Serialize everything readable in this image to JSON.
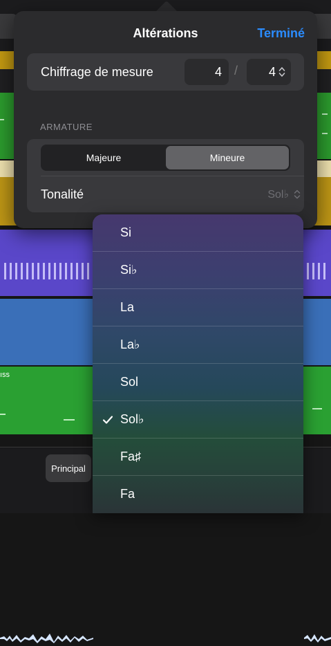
{
  "popover": {
    "title": "Altérations",
    "done_label": "Terminé",
    "time_signature": {
      "label": "Chiffrage de mesure",
      "numerator": "4",
      "separator": "/",
      "denominator": "4"
    },
    "armature": {
      "section_header": "ARMATURE",
      "segments": [
        "Majeure",
        "Mineure"
      ],
      "selected_segment": "Mineure",
      "key_label": "Tonalité",
      "key_value": "Sol♭"
    }
  },
  "key_menu": {
    "items": [
      "Si",
      "Si♭",
      "La",
      "La♭",
      "Sol",
      "Sol♭",
      "Fa♯",
      "Fa"
    ],
    "selected": "Sol♭",
    "check_icon": "checkmark-icon"
  },
  "background": {
    "track_label": "ıss",
    "footer_button": "Principal"
  },
  "colors": {
    "accent": "#2b8cff",
    "popover_bg": "#2b2b2d",
    "track_gold": "#c49a12",
    "track_green": "#2c9c2e",
    "track_purple": "#5a47c9",
    "track_blue": "#3a6fb8"
  }
}
